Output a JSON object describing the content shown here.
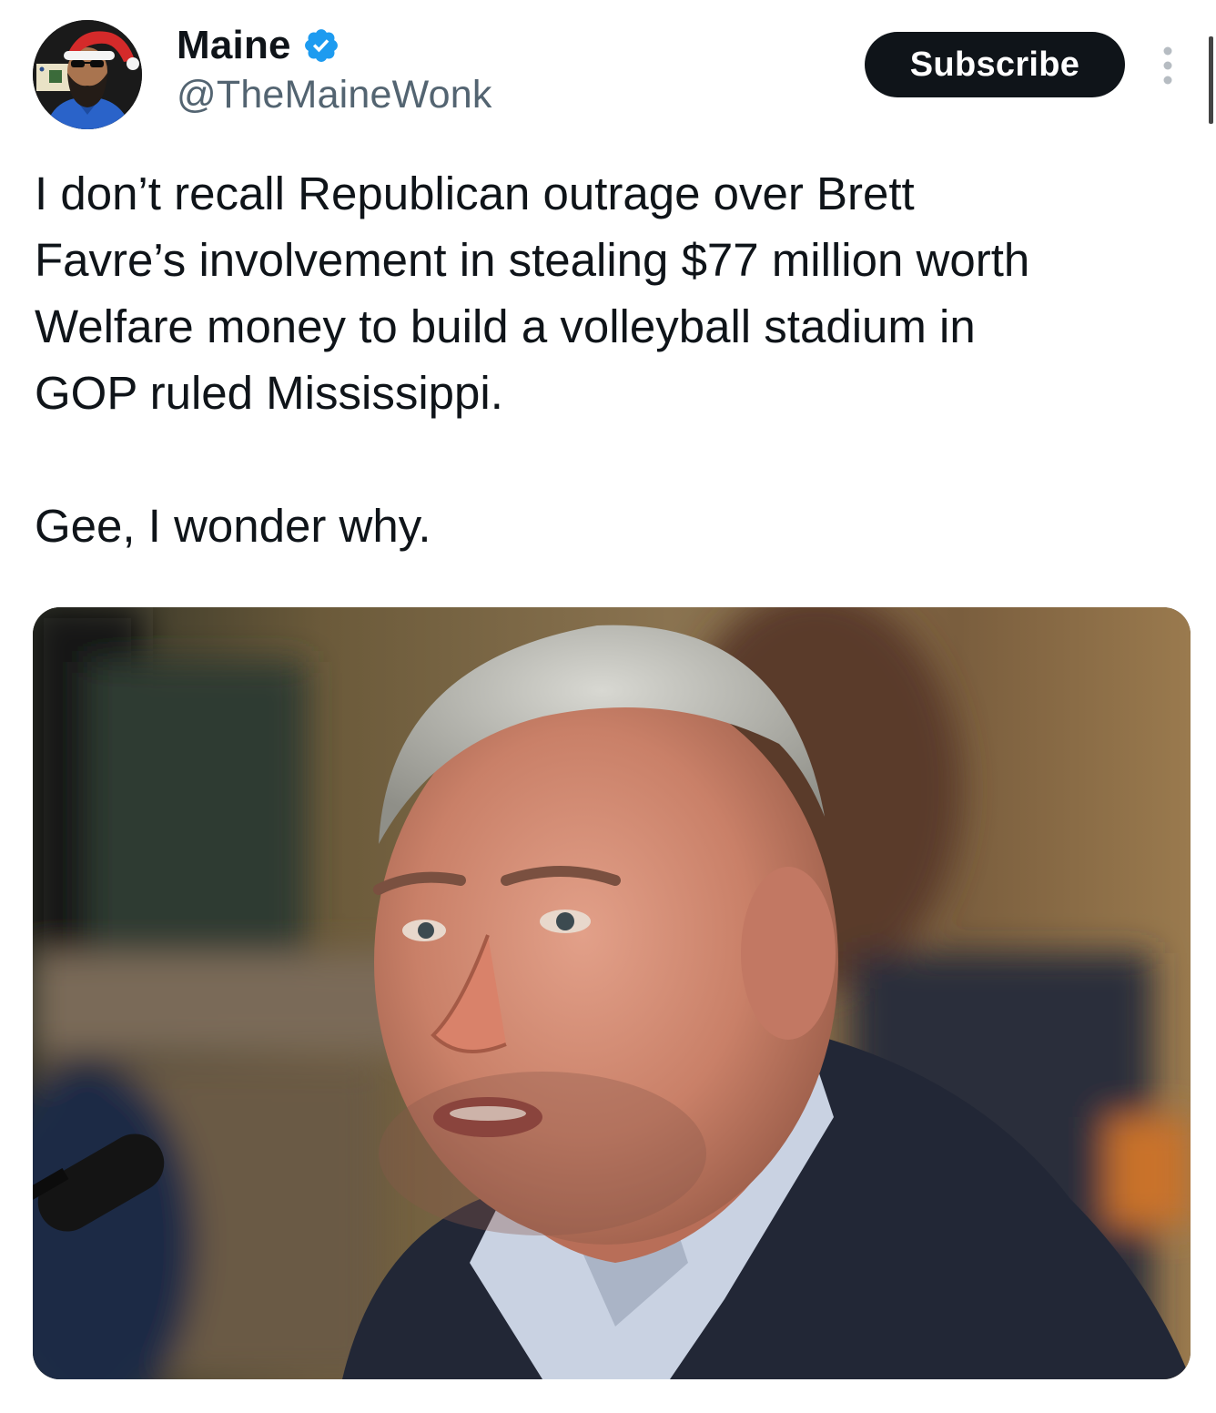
{
  "author": {
    "display_name": "Maine",
    "handle": "@TheMaineWonk",
    "avatar": "avatar-photo",
    "verified_icon": "verified-badge-icon",
    "verified_color": "#1d9bf0"
  },
  "actions": {
    "subscribe_label": "Subscribe",
    "more_icon": "more-vertical-icon"
  },
  "tweet": {
    "lines": [
      "I don’t recall Republican outrage over Brett",
      "Favre’s involvement in stealing $77 million worth",
      "Welfare money to build a volleyball stadium in",
      "GOP ruled Mississippi."
    ],
    "closing": "Gee, I wonder why."
  },
  "media": {
    "type": "photo"
  },
  "colors": {
    "text": "#0f1419",
    "secondary_text": "#536471",
    "button_bg": "#0f1419",
    "button_text": "#ffffff"
  }
}
